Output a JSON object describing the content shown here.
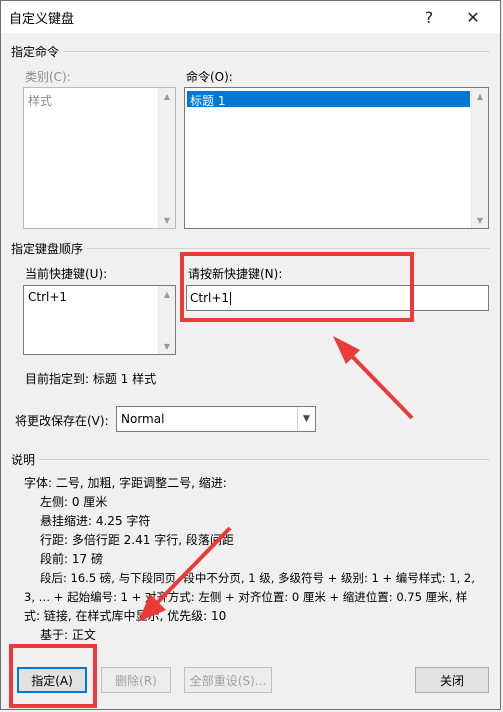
{
  "window": {
    "title": "自定义键盘",
    "help": "?",
    "close": "✕"
  },
  "commands_group": {
    "label": "指定命令",
    "category_label": "类别(C):",
    "category_items": [
      "样式"
    ],
    "command_label": "命令(O):",
    "command_items": [
      "标题 1"
    ]
  },
  "keys_group": {
    "label": "指定键盘顺序",
    "current_label": "当前快捷键(U):",
    "current_items": [
      "Ctrl+1"
    ],
    "new_label": "请按新快捷键(N):",
    "new_value": "Ctrl+1",
    "assigned_to": "目前指定到:  标题 1 样式"
  },
  "save_in": {
    "label": "将更改保存在(V):",
    "value": "Normal"
  },
  "description": {
    "label": "说明",
    "lines": [
      "字体: 二号, 加粗, 字距调整二号, 缩进:",
      "左侧:  0 厘米",
      "悬挂缩进: 4.25 字符",
      "行距: 多倍行距 2.41 字行, 段落间距",
      "段前: 17 磅",
      "段后: 16.5 磅, 与下段同页, 段中不分页, 1 级, 多级符号 + 级别: 1 + 编号样式: 1, 2,",
      "3, … + 起始编号: 1 + 对齐方式: 左侧 + 对齐位置:  0 厘米 + 缩进位置:  0.75 厘米, 样",
      "式: 链接, 在样式库中显示, 优先级: 10",
      "基于: 正文"
    ]
  },
  "buttons": {
    "assign": "指定(A)",
    "remove": "删除(R)",
    "reset_all": "全部重设(S)...",
    "close": "关闭"
  },
  "colors": {
    "annotation_red": "#ea3a3a",
    "selection_blue": "#0078d7"
  }
}
